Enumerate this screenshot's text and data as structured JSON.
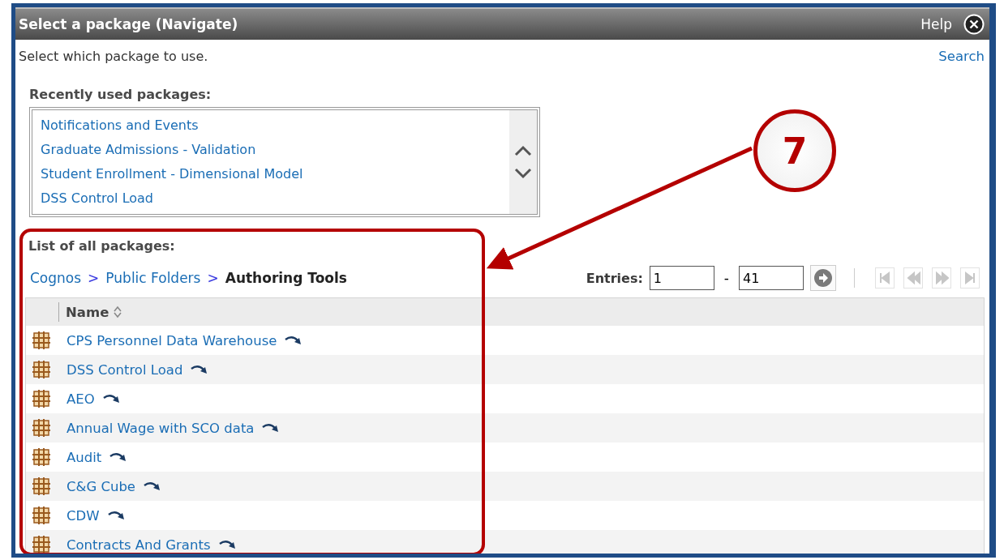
{
  "dialog": {
    "title": "Select a package (Navigate)",
    "help": "Help",
    "subtitle": "Select which package to use.",
    "search_link": "Search"
  },
  "recent": {
    "heading": "Recently used packages:",
    "items": [
      "Notifications and Events",
      "Graduate Admissions - Validation",
      "Student Enrollment - Dimensional Model",
      "DSS Control Load"
    ]
  },
  "all_packages": {
    "heading": "List of all packages:",
    "breadcrumb": [
      {
        "label": "Cognos",
        "current": false
      },
      {
        "label": ">",
        "kind": "separator"
      },
      {
        "label": "Public Folders",
        "current": false
      },
      {
        "label": ">",
        "kind": "separator"
      },
      {
        "label": "Authoring Tools",
        "current": true
      }
    ],
    "entries": {
      "label": "Entries:",
      "from": "1",
      "separator": "-",
      "to": "41"
    },
    "pager": [
      {
        "kind": "first",
        "disabled": true
      },
      {
        "kind": "previous",
        "disabled": true
      },
      {
        "kind": "next",
        "disabled": true
      },
      {
        "kind": "last",
        "disabled": true
      }
    ],
    "column": "Name",
    "rows": [
      "CPS Personnel Data Warehouse",
      "DSS Control Load",
      "AEO",
      "Annual Wage with SCO data",
      "Audit",
      "C&G Cube",
      "CDW",
      "Contracts And Grants"
    ]
  },
  "annotation": {
    "number": "7"
  }
}
